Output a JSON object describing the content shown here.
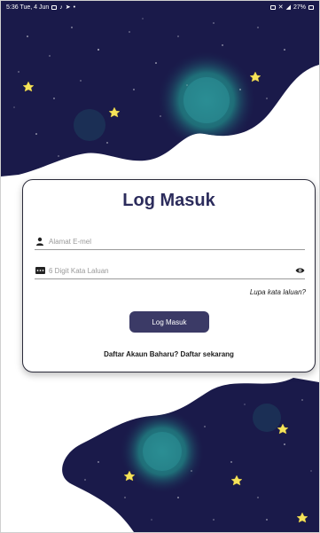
{
  "status_bar": {
    "time_date": "5:36  Tue, 4 Jun",
    "battery": "27%"
  },
  "login": {
    "title": "Log Masuk",
    "email_placeholder": "Alamat E-mel",
    "password_placeholder": "6 Digit Kata Laluan",
    "forgot_password": "Lupa kata laluan?",
    "login_button": "Log Masuk",
    "signup_prompt": "Daftar Akaun Baharu? Daftar sekarang"
  },
  "colors": {
    "night_sky": "#1a1a4a",
    "glow": "#1f6e78",
    "star": "#f5e35a",
    "button": "#3b3a66",
    "title": "#2c2c5c"
  },
  "icons": {
    "email": "person-icon",
    "password": "pin-dots-icon",
    "toggle": "eye-icon"
  }
}
